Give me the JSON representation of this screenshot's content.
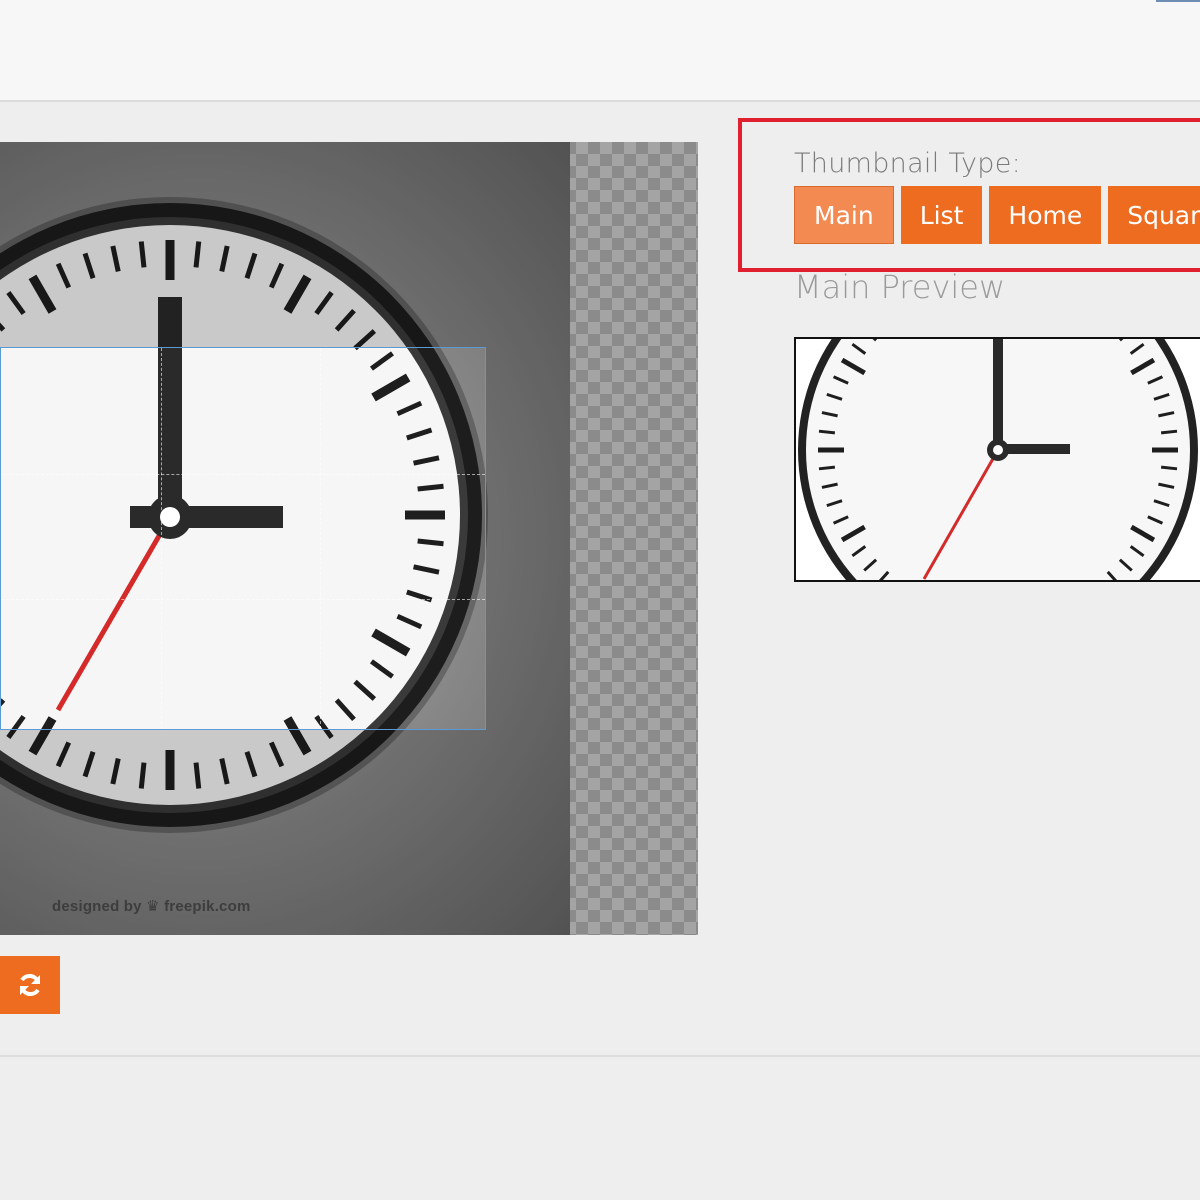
{
  "editor": {
    "watermark": "designed by ♛ freepik.com",
    "refresh_icon": "refresh-icon"
  },
  "thumbnail": {
    "label": "Thumbnail Type:",
    "tabs": [
      {
        "label": "Main",
        "active": true
      },
      {
        "label": "List",
        "active": false
      },
      {
        "label": "Home",
        "active": false
      },
      {
        "label": "Square",
        "active": false
      }
    ]
  },
  "preview": {
    "title": "Main Preview"
  },
  "colors": {
    "accent": "#ee6c1f",
    "accent_active": "#f28a52",
    "highlight_frame": "#e0202e",
    "crop_border": "#5b9bd5"
  }
}
